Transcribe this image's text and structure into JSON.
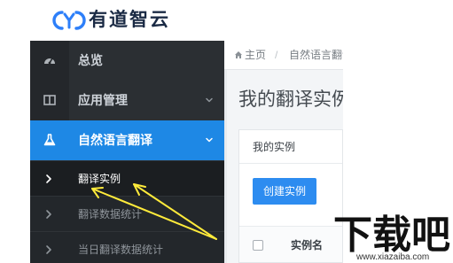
{
  "brand": {
    "name": "有道智云"
  },
  "sidebar": {
    "items": [
      {
        "label": "总览",
        "icon": "dashboard-icon"
      },
      {
        "label": "应用管理",
        "icon": "columns-icon"
      },
      {
        "label": "自然语言翻译",
        "icon": "flask-icon"
      }
    ],
    "subitems": [
      {
        "label": "翻译实例"
      },
      {
        "label": "翻译数据统计"
      },
      {
        "label": "当日翻译数据统计"
      }
    ]
  },
  "breadcrumb": {
    "home": "主页",
    "separator": "/",
    "current": "自然语言翻译"
  },
  "main": {
    "title": "我的翻译实例",
    "panel_title": "我的实例",
    "create_button": "创建实例",
    "table_headers": [
      "实例名"
    ]
  },
  "watermark": {
    "text": "下载吧",
    "url": "www.xiazaiba.com"
  },
  "colors": {
    "sidebar_bg": "#2b2f33",
    "active_blue": "#1e88e5",
    "button_blue": "#2d8cf0",
    "arrow_yellow": "#ffeb3b"
  }
}
